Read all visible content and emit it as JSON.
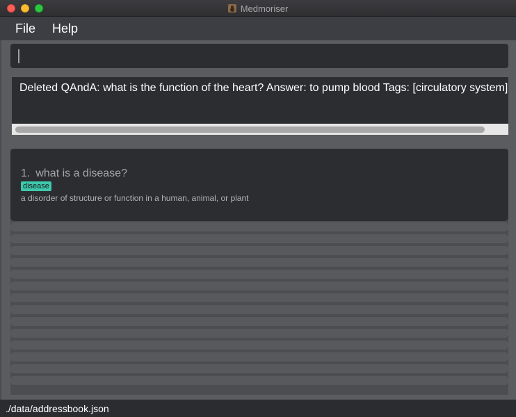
{
  "window": {
    "title": "Medmoriser"
  },
  "menu": {
    "items": [
      "File",
      "Help"
    ]
  },
  "command": {
    "value": "",
    "placeholder": ""
  },
  "result": {
    "text": "Deleted QAndA: what is the function of the heart? Answer: to pump blood Tags: [circulatory system]"
  },
  "list": {
    "items": [
      {
        "index": "1.",
        "question": "what is a disease?",
        "tags": [
          "disease"
        ],
        "answer": "a disorder of structure or function in a human, animal, or plant"
      }
    ]
  },
  "status": {
    "path": "./data/addressbook.json"
  },
  "colors": {
    "tag": "#3ec9ad",
    "card": "#2c2d31",
    "panel": "#4c4d50",
    "close": "#ff5f57",
    "minimize": "#febc2e",
    "maximize": "#28c840"
  }
}
